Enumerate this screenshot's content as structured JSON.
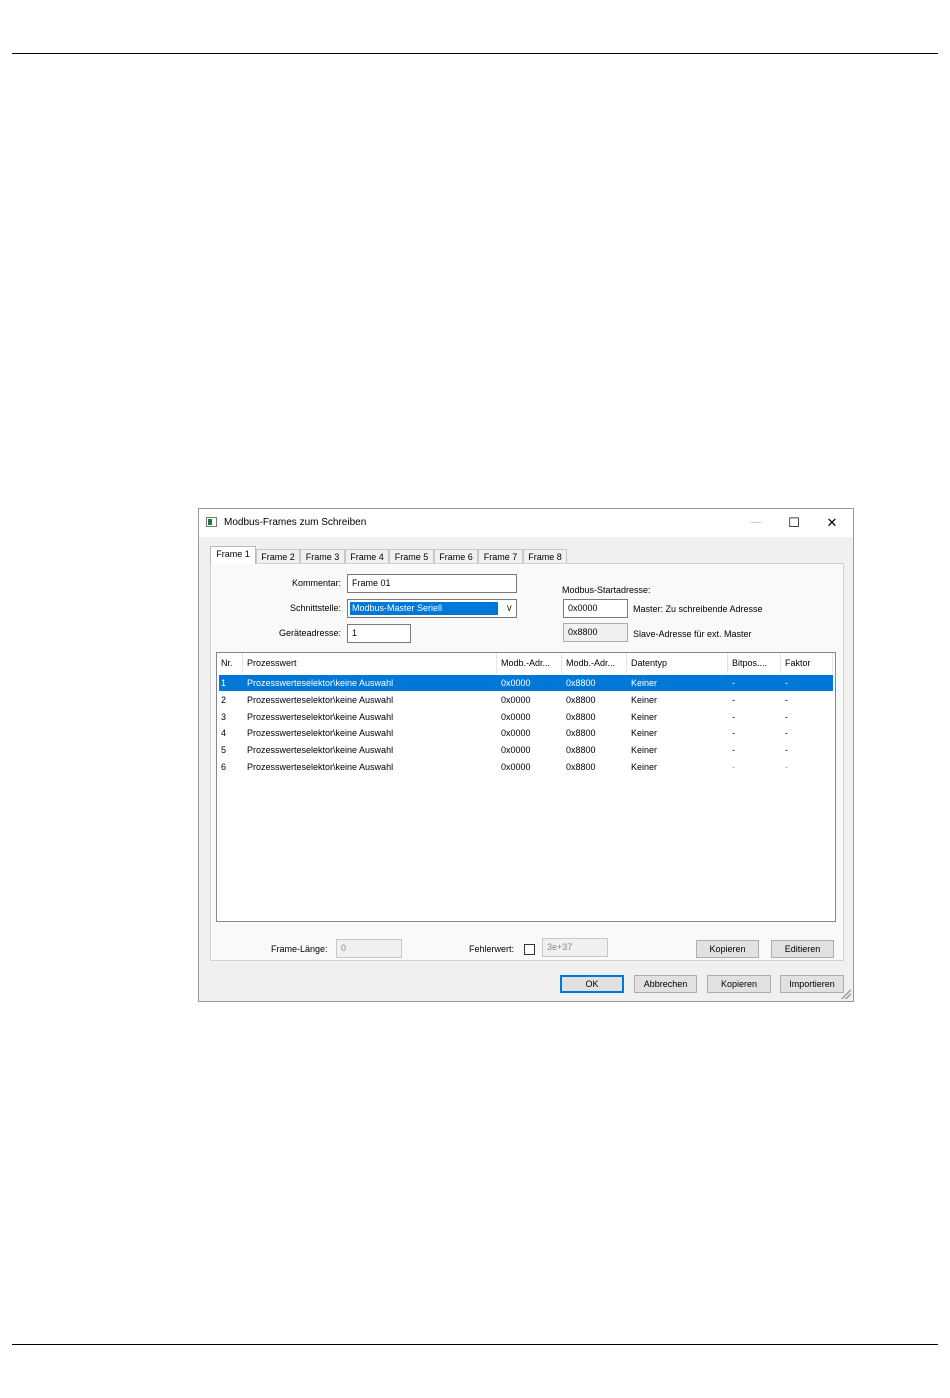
{
  "dialog": {
    "title": "Modbus-Frames zum Schreiben",
    "minimize_glyph": "—",
    "maximize_glyph": "☐",
    "close_glyph": "✕"
  },
  "tabs": [
    "Frame 1",
    "Frame 2",
    "Frame 3",
    "Frame 4",
    "Frame 5",
    "Frame 6",
    "Frame 7",
    "Frame 8"
  ],
  "form": {
    "kommentar_label": "Kommentar:",
    "kommentar_value": "Frame 01",
    "schnittstelle_label": "Schnittstelle:",
    "schnittstelle_value": "Modbus-Master Seriell",
    "geraeteadresse_label": "Geräteadresse:",
    "geraeteadresse_value": "1",
    "startadresse_label": "Modbus-Startadresse:",
    "master_addr_value": "0x0000",
    "master_addr_label": "Master: Zu schreibende Adresse",
    "slave_addr_value": "0x8800",
    "slave_addr_label": "Slave-Adresse für ext. Master"
  },
  "table": {
    "columns": [
      "Nr.",
      "Prozesswert",
      "Modb.-Adr...",
      "Modb.-Adr...",
      "Datentyp",
      "Bitpos....",
      "Faktor"
    ],
    "rows": [
      {
        "nr": "1",
        "prozesswert": "Prozesswerteselektor\\keine Auswahl",
        "adr1": "0x0000",
        "adr2": "0x8800",
        "datentyp": "Keiner",
        "bitpos": "-",
        "faktor": "-"
      },
      {
        "nr": "2",
        "prozesswert": "Prozesswerteselektor\\keine Auswahl",
        "adr1": "0x0000",
        "adr2": "0x8800",
        "datentyp": "Keiner",
        "bitpos": "-",
        "faktor": "-"
      },
      {
        "nr": "3",
        "prozesswert": "Prozesswerteselektor\\keine Auswahl",
        "adr1": "0x0000",
        "adr2": "0x8800",
        "datentyp": "Keiner",
        "bitpos": "-",
        "faktor": "-"
      },
      {
        "nr": "4",
        "prozesswert": "Prozesswerteselektor\\keine Auswahl",
        "adr1": "0x0000",
        "adr2": "0x8800",
        "datentyp": "Keiner",
        "bitpos": "-",
        "faktor": "-"
      },
      {
        "nr": "5",
        "prozesswert": "Prozesswerteselektor\\keine Auswahl",
        "adr1": "0x0000",
        "adr2": "0x8800",
        "datentyp": "Keiner",
        "bitpos": "-",
        "faktor": "-"
      },
      {
        "nr": "6",
        "prozesswert": "Prozesswerteselektor\\keine Auswahl",
        "adr1": "0x0000",
        "adr2": "0x8800",
        "datentyp": "Keiner",
        "bitpos": "-",
        "faktor": "-"
      }
    ],
    "selected_row": 1
  },
  "footer": {
    "frame_laenge_label": "Frame-Länge:",
    "frame_laenge_value": "0",
    "fehlerwert_label": "Fehlerwert:",
    "fehlerwert_checked": false,
    "fehlerwert_value": "3e+37",
    "kopieren_label": "Kopieren",
    "editieren_label": "Editieren"
  },
  "buttons": {
    "ok": "OK",
    "abbrechen": "Abbrechen",
    "kopieren": "Kopieren",
    "importieren": "Importieren"
  },
  "colors": {
    "selection": "#0078d7",
    "dialog_bg": "#f0f0f0"
  }
}
